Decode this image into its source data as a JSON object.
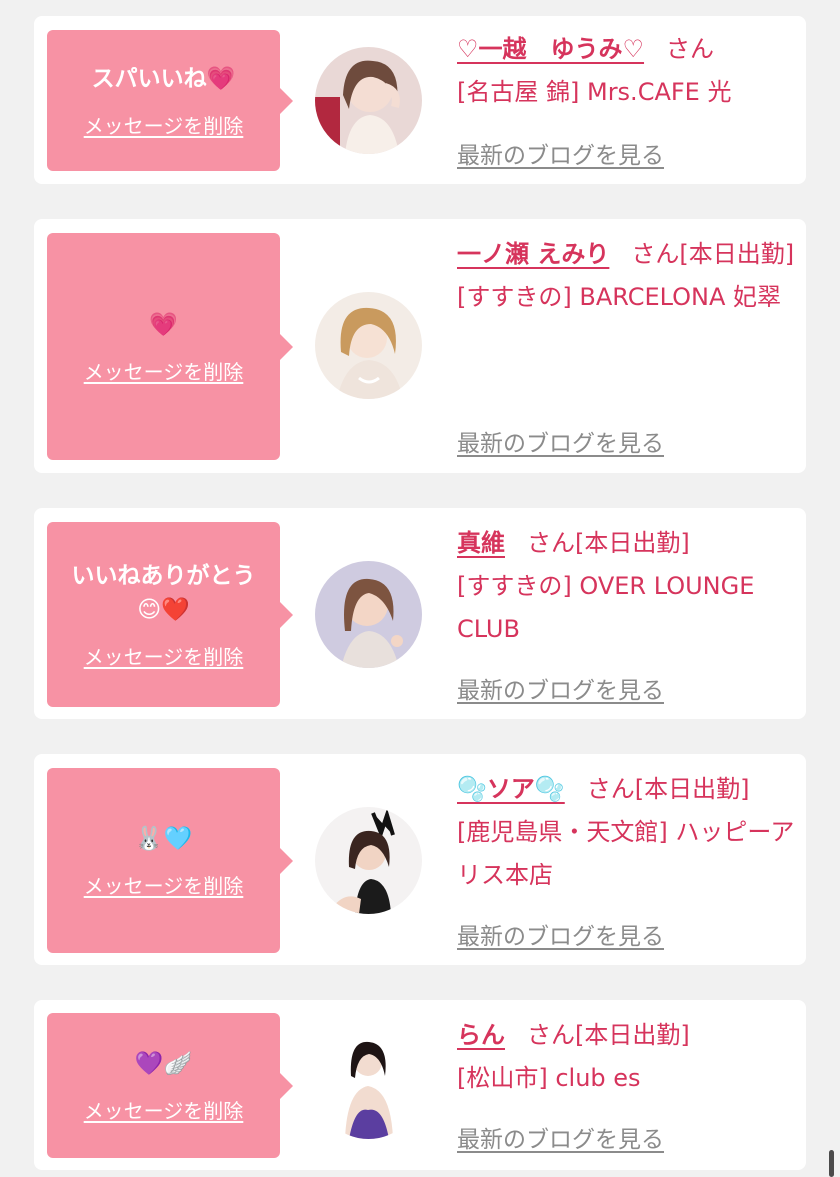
{
  "delete_label": "メッセージを削除",
  "blog_label": "最新のブログを見る",
  "san_label": "さん",
  "cards": [
    {
      "message": "スパいいね💗",
      "name": "♡一越　ゆうみ♡",
      "status_tag": "",
      "shop": "[名古屋 錦] Mrs.CAFE 光",
      "avatar_icon": "woman-portrait-icon"
    },
    {
      "message": "💗",
      "name": "一ノ瀬 えみり",
      "status_tag": "[本日出勤]",
      "shop": "[すすきの] BARCELONA 妃翠",
      "avatar_icon": "woman-portrait-icon"
    },
    {
      "message": "いいねありがとう😊❤️",
      "name": "真維",
      "status_tag": "[本日出勤]",
      "shop": "[すすきの] OVER LOUNGE CLUB",
      "avatar_icon": "woman-portrait-icon"
    },
    {
      "message": "🐰🩵",
      "name": "🫧ソア🫧",
      "status_tag": "[本日出勤]",
      "shop": "[鹿児島県・天文館] ハッピーアリス本店",
      "avatar_icon": "woman-portrait-icon"
    },
    {
      "message": "💜🪽",
      "name": "らん",
      "status_tag": "[本日出勤]",
      "shop": "[松山市] club es",
      "avatar_icon": "woman-portrait-icon"
    }
  ],
  "colors": {
    "background": "#f1f1f1",
    "card": "#ffffff",
    "bubble": "#f792a4",
    "accent": "#d6345c",
    "link_gray": "#8b8b8b"
  }
}
